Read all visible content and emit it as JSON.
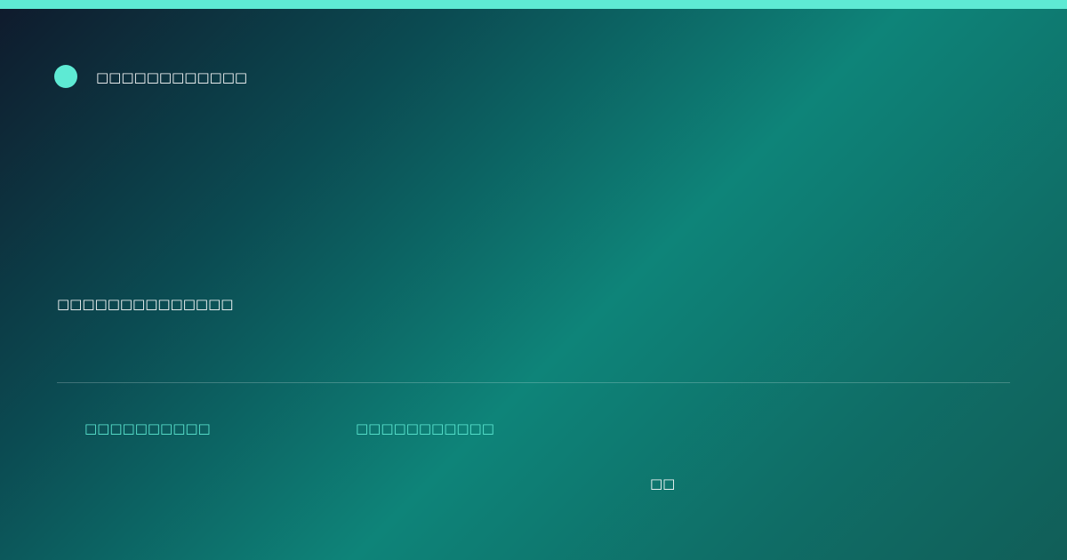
{
  "brand": {
    "name": "□□□□□□□□□□□□"
  },
  "headline": {
    "text": "□□□□□□□□□□□□□□"
  },
  "meta": {
    "item_1": "□□□□□□□□□□",
    "item_2": "□□□□□□□□□□□"
  },
  "footer": {
    "text": "□□"
  },
  "colors": {
    "accent": "#5eead4",
    "text": "#ffffff",
    "gradient_start": "#0f1a2c",
    "gradient_mid": "#0e8479",
    "gradient_end": "#115e58"
  }
}
